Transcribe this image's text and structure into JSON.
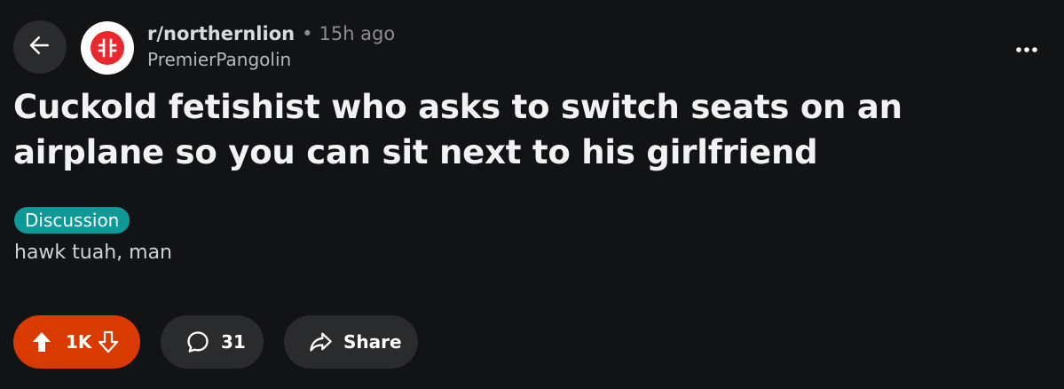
{
  "header": {
    "subreddit": "r/northernlion",
    "separator": "•",
    "time": "15h ago",
    "author": "PremierPangolin",
    "back_icon": "arrow-left-icon",
    "more_icon": "ellipsis-horizontal-icon",
    "avatar_icon": "subreddit-logo-icon"
  },
  "post": {
    "title": "Cuckold fetishist who asks to switch seats on an airplane so you can sit next to his girlfriend",
    "flair": "Discussion",
    "body": "hawk tuah, man"
  },
  "actions": {
    "score": "1K",
    "comments": "31",
    "share": "Share",
    "upvote_icon": "upvote-arrow-icon",
    "downvote_icon": "downvote-arrow-icon",
    "comment_icon": "comment-bubble-icon",
    "share_icon": "share-arrow-icon"
  },
  "colors": {
    "background": "#121315",
    "button_bg": "#2a2b2d",
    "vote_active": "#d93a00",
    "flair": "#0c9997",
    "avatar_accent": "#e8282e"
  }
}
